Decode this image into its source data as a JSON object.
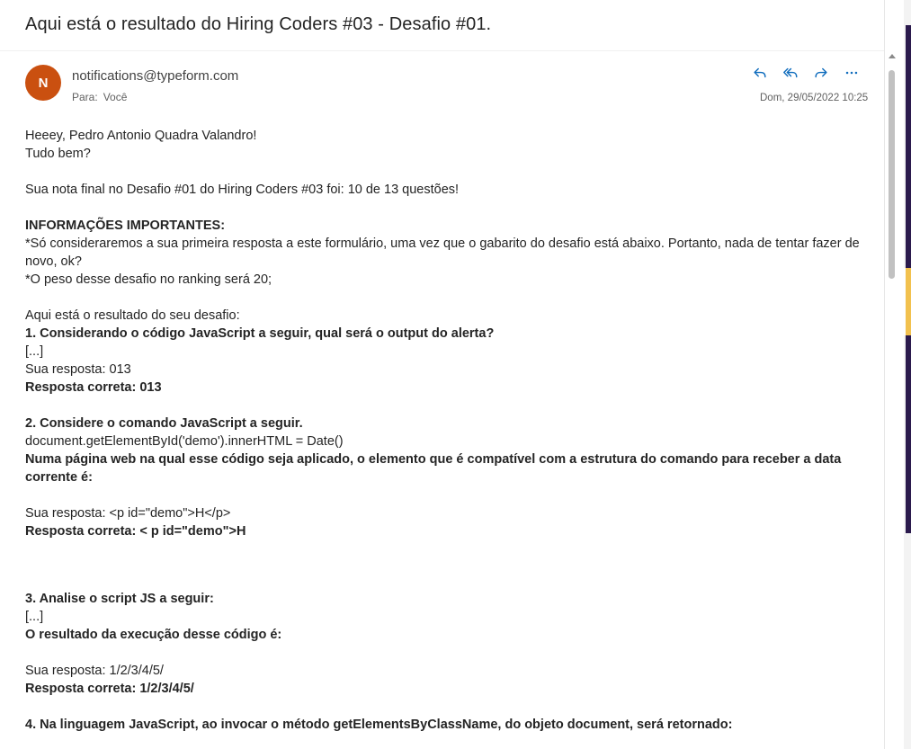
{
  "email": {
    "subject": "Aqui está o resultado do Hiring Coders #03 - Desafio #01.",
    "avatar_initial": "N",
    "avatar_color": "#ca5010",
    "sender": "notifications@typeform.com",
    "to_label": "Para:",
    "to_value": "Você",
    "date": "Dom, 29/05/2022 10:25",
    "actions": [
      {
        "icon": "reply-icon"
      },
      {
        "icon": "reply-all-icon"
      },
      {
        "icon": "forward-icon"
      },
      {
        "icon": "more-icon"
      }
    ],
    "accent_color": "#0f6cbd"
  },
  "body": {
    "greeting": "Heeey, Pedro Antonio Quadra Valandro!",
    "how_are_you": "Tudo bem?",
    "score": "Sua nota final no Desafio #01 do Hiring Coders #03 foi: 10 de 13 questões!",
    "important_title": "INFORMAÇÕES IMPORTANTES:",
    "important_1": "*Só consideraremos a sua primeira resposta a este formulário, uma vez que o gabarito do desafio está abaixo. Portanto, nada de tentar fazer de novo, ok?",
    "important_2": "*O peso desse desafio no ranking será 20;",
    "results_intro": "Aqui está o resultado do seu desafio:",
    "q1_title": "1. Considerando o código JavaScript a seguir, qual será o output do alerta?",
    "q1_ellipsis": "[...]",
    "q1_answer": "Sua resposta: 013",
    "q1_correct": "Resposta correta: 013",
    "q2_title": "2. Considere o comando JavaScript a seguir.",
    "q2_code": "document.getElementById('demo').innerHTML = Date()",
    "q2_question": "Numa página web na qual esse código seja aplicado, o elemento que é compatível com a estrutura do comando para receber a data corrente é:",
    "q2_answer": "Sua resposta: <p id=\"demo\">H</p>",
    "q2_correct": "Resposta correta: < p id=\"demo\">H",
    "q3_title": "3. Analise o script JS a seguir:",
    "q3_ellipsis": "[...]",
    "q3_question": "O resultado da execução desse código é:",
    "q3_answer": "Sua resposta: 1/2/3/4/5/",
    "q3_correct": "Resposta correta: 1/2/3/4/5/",
    "q4_title": "4. Na linguagem JavaScript, ao invocar o método getElementsByClassName, do objeto document, será retornado:"
  }
}
